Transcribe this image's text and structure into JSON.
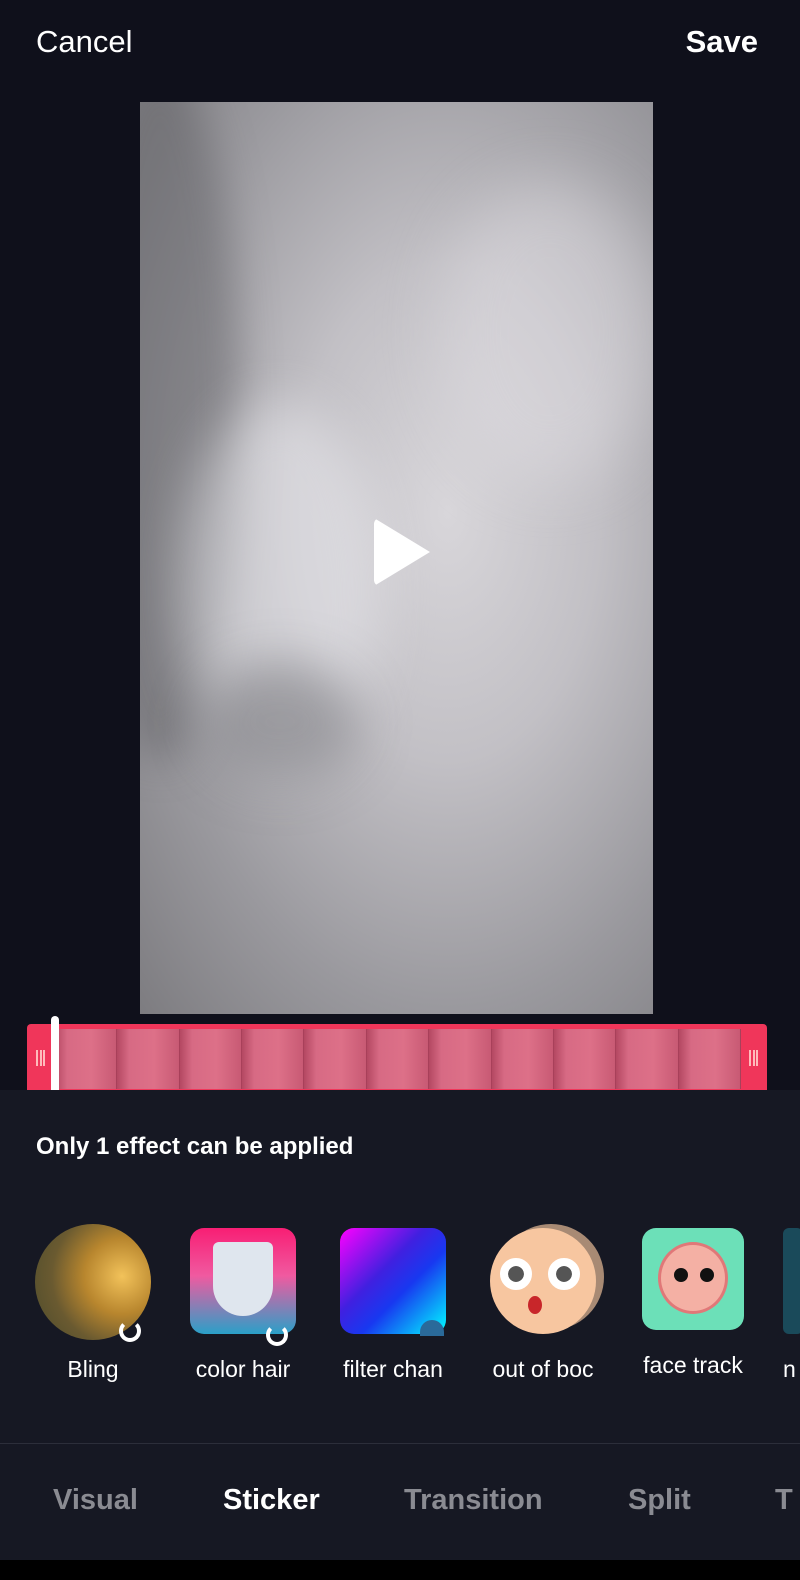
{
  "header": {
    "cancel_label": "Cancel",
    "save_label": "Save"
  },
  "player": {
    "play_icon": "play-icon"
  },
  "timeline": {
    "frame_count": 11,
    "accent": "#f0365a",
    "playhead_position": 0
  },
  "effects_panel": {
    "hint": "Only 1 effect can be applied",
    "effects": [
      {
        "label": "Bling",
        "status": "loading"
      },
      {
        "label": "color hair",
        "status": "loading"
      },
      {
        "label": "filter chan",
        "status": "downloadable"
      },
      {
        "label": "out of boc"
      },
      {
        "label": "face track"
      },
      {
        "label": "n"
      }
    ]
  },
  "tabs": [
    {
      "label": "Visual",
      "active": false
    },
    {
      "label": "Sticker",
      "active": true
    },
    {
      "label": "Transition",
      "active": false
    },
    {
      "label": "Split",
      "active": false
    },
    {
      "label": "T",
      "active": false
    }
  ]
}
